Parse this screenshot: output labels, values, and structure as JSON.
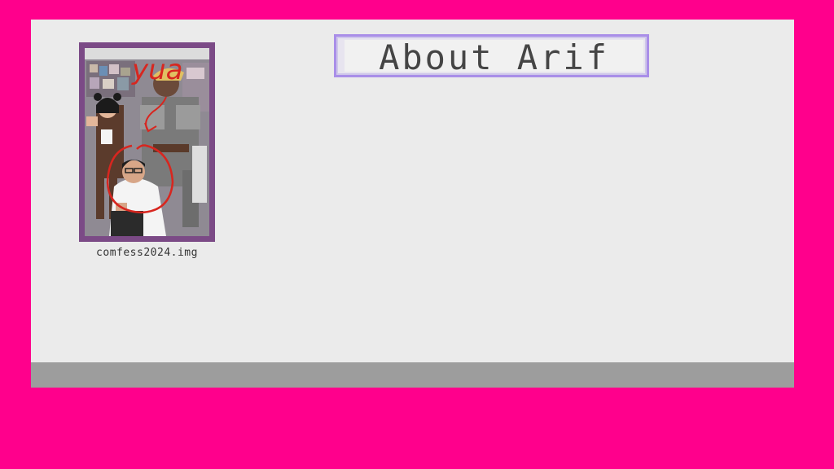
{
  "photo": {
    "caption": "comfess2024.img",
    "annotation_text": "yua",
    "annotation_color": "#d8261f"
  },
  "header": {
    "title": "About Arif"
  },
  "colors": {
    "background": "#ff008c",
    "window": "#ebebeb",
    "footer": "#9d9d9d",
    "photo_frame": "#7b4a86",
    "title_border": "#a98ee8"
  }
}
